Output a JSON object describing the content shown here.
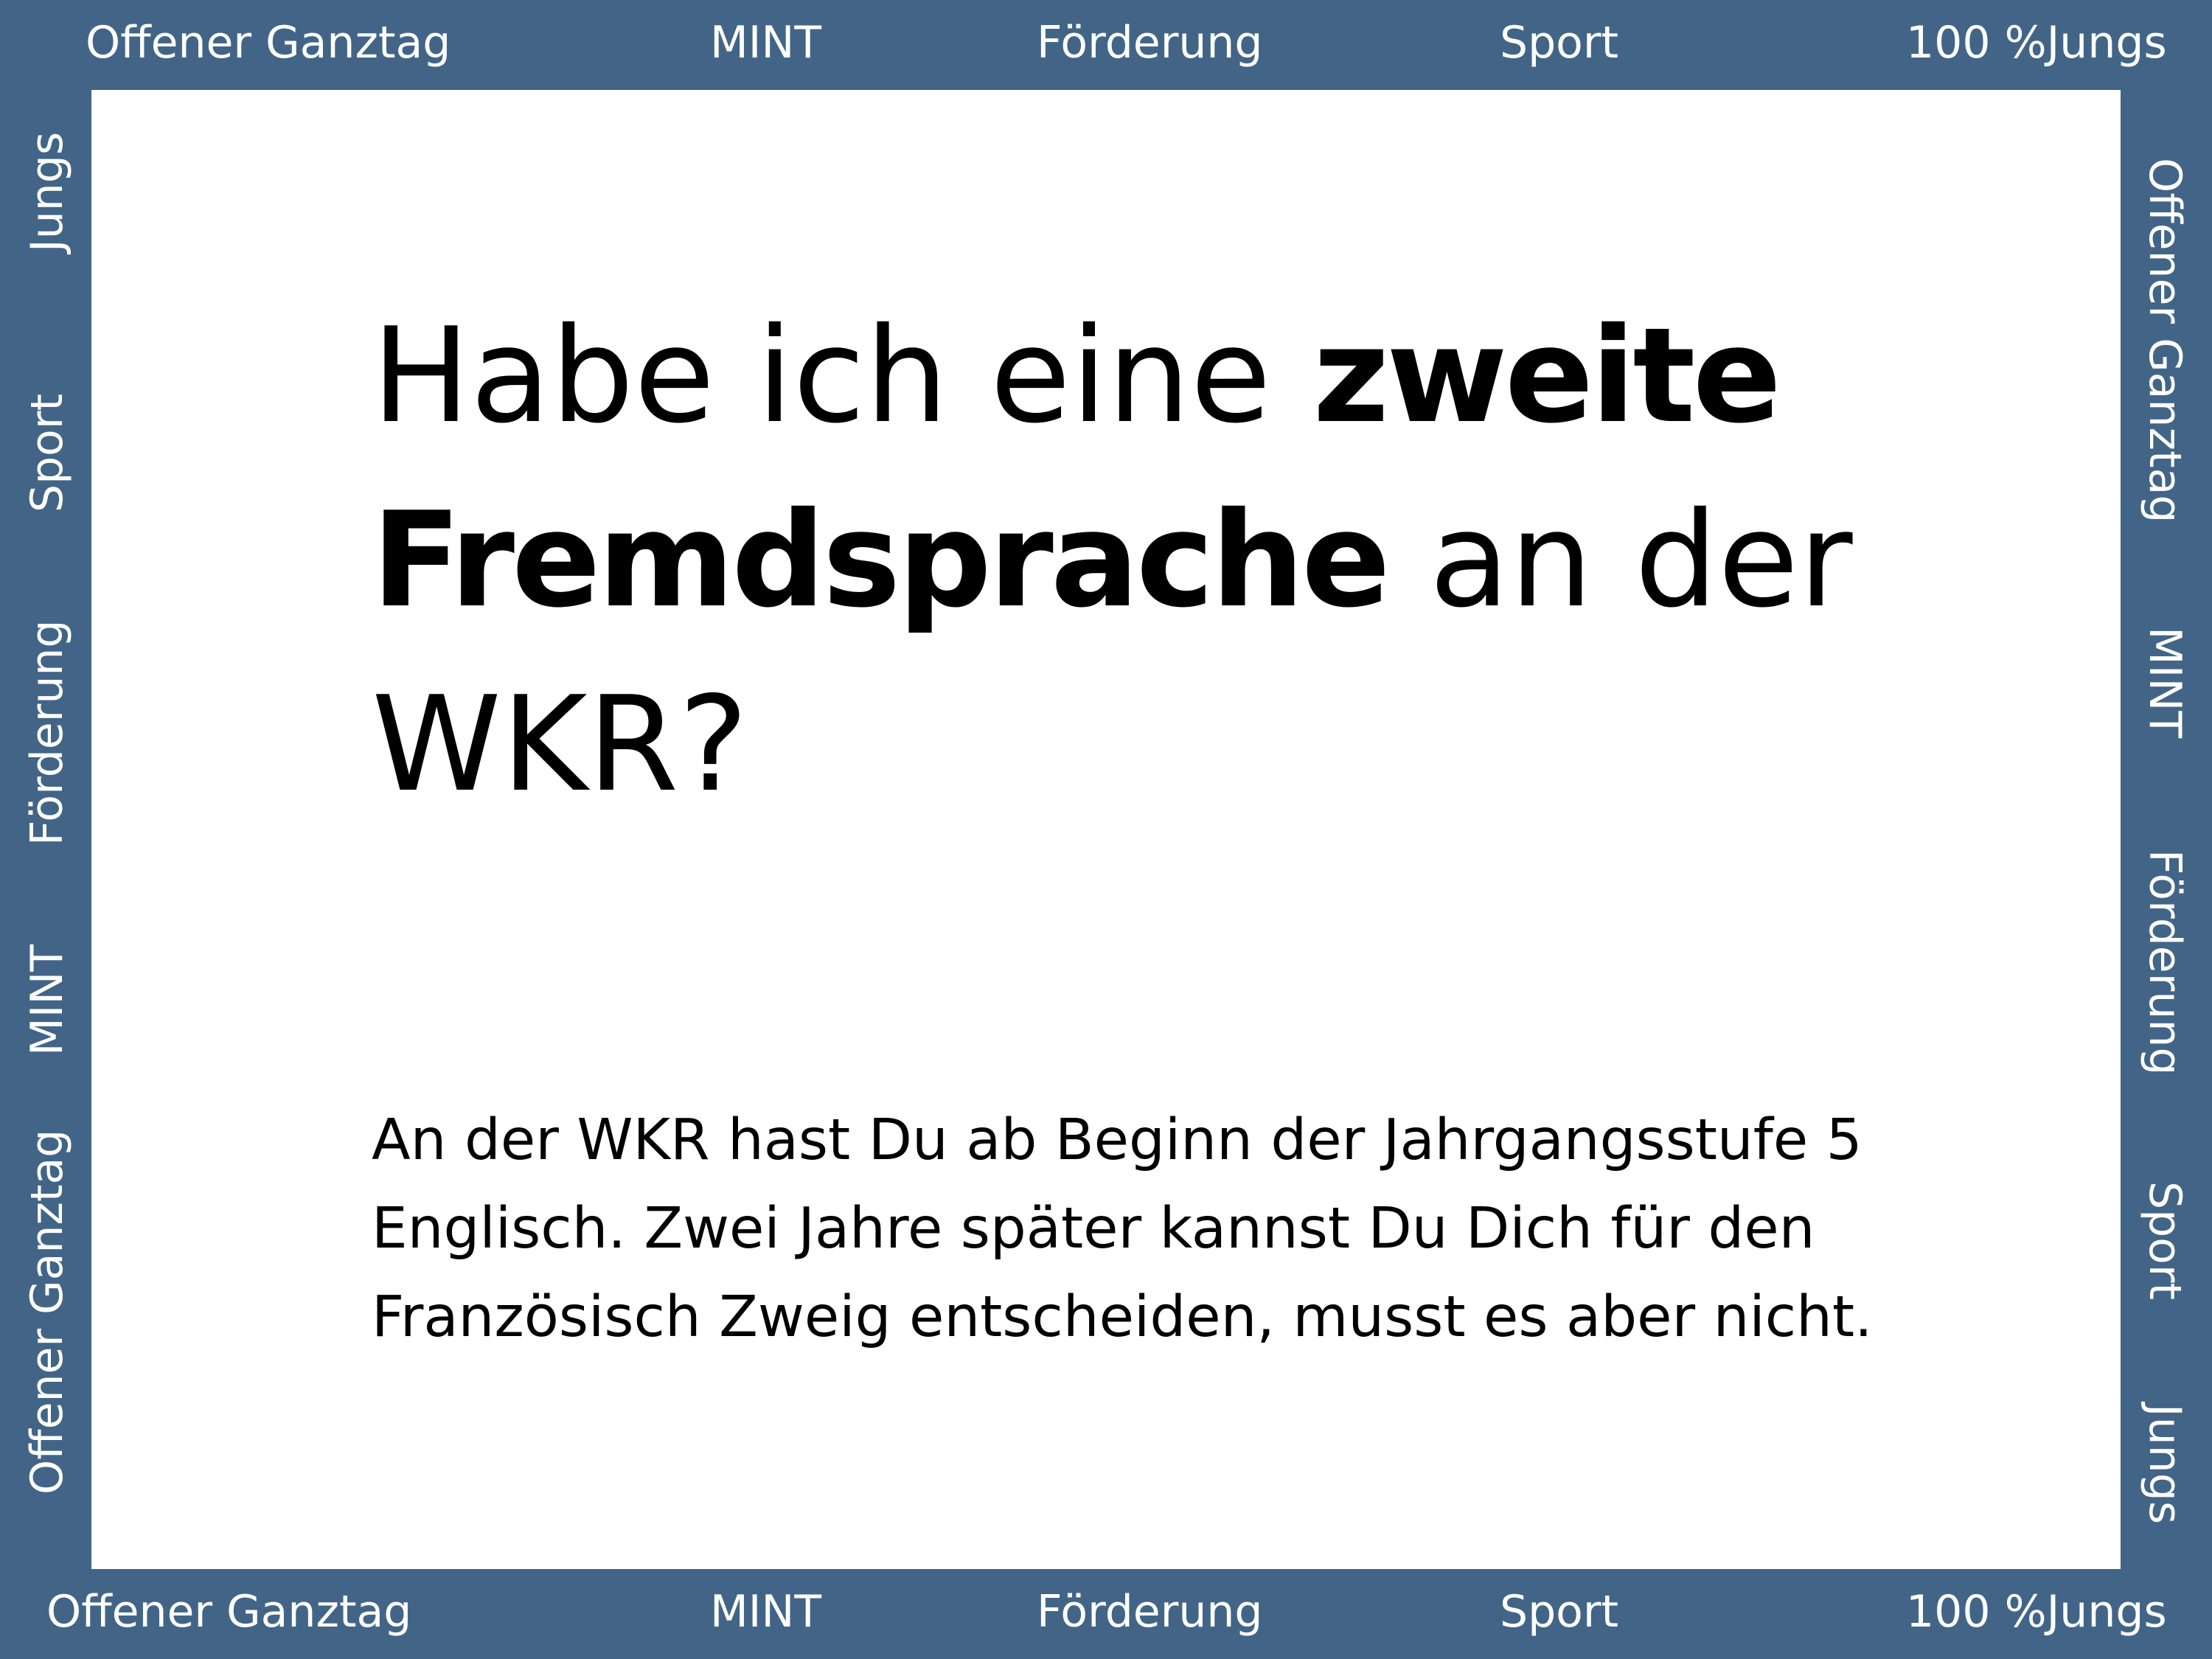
{
  "frame": {
    "top": [
      "Offener Ganztag",
      "MINT",
      "Förderung",
      "Sport",
      "100 %Jungs"
    ],
    "bottom": [
      "Offener Ganztag",
      "MINT",
      "Förderung",
      "Sport",
      "100 %Jungs"
    ],
    "left": [
      "Jungs",
      "Sport",
      "Förderung",
      "MINT",
      "Offener Ganztag"
    ],
    "right": [
      "Offener Ganztag",
      "MINT",
      "Förderung",
      "Sport",
      "Jungs"
    ]
  },
  "heading": {
    "part1": "Habe ich eine ",
    "emphasis": "zweite Fremdsprache",
    "part2": " an der WKR?"
  },
  "body": {
    "text": "An der WKR hast Du ab Beginn der Jahrgangsstufe 5 Englisch. Zwei Jahre später kannst Du Dich für den Französisch Zweig entscheiden, musst es aber nicht."
  },
  "colors": {
    "frame": "#426587",
    "frame_text": "#ffffff",
    "background": "#ffffff",
    "text": "#000000"
  }
}
